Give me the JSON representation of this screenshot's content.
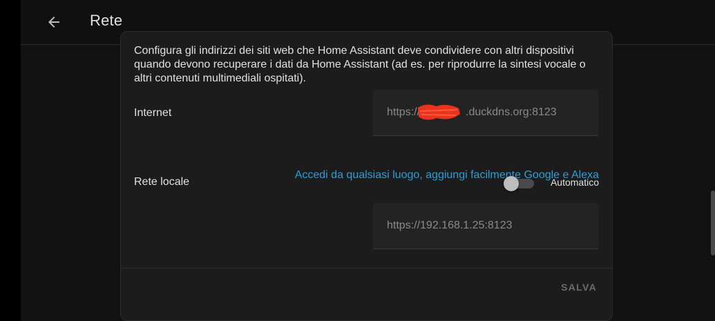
{
  "header": {
    "title": "Rete",
    "back_icon": "arrow-back-icon"
  },
  "card": {
    "description": "Configura gli indirizzi dei siti web che Home Assistant deve condividere con altri dispositivi quando devono recuperare i dati da Home Assistant (ad es. per riprodurre la sintesi vocale o altri contenuti multimediali ospitati).",
    "internet": {
      "label": "Internet",
      "value_prefix": "https://",
      "value_suffix": ".duckdns.org:8123"
    },
    "cloud_link": "Accedi da qualsiasi luogo, aggiungi facilmente Google e Alexa",
    "local": {
      "label": "Rete locale",
      "toggle_label": "Automatico",
      "toggle_on": false,
      "value": "https://192.168.1.25:8123"
    },
    "save_label": "SALVA"
  },
  "colors": {
    "link": "#2a9fd8",
    "redaction": "#e8341f",
    "background": "#111111",
    "card": "#1c1c1c"
  }
}
